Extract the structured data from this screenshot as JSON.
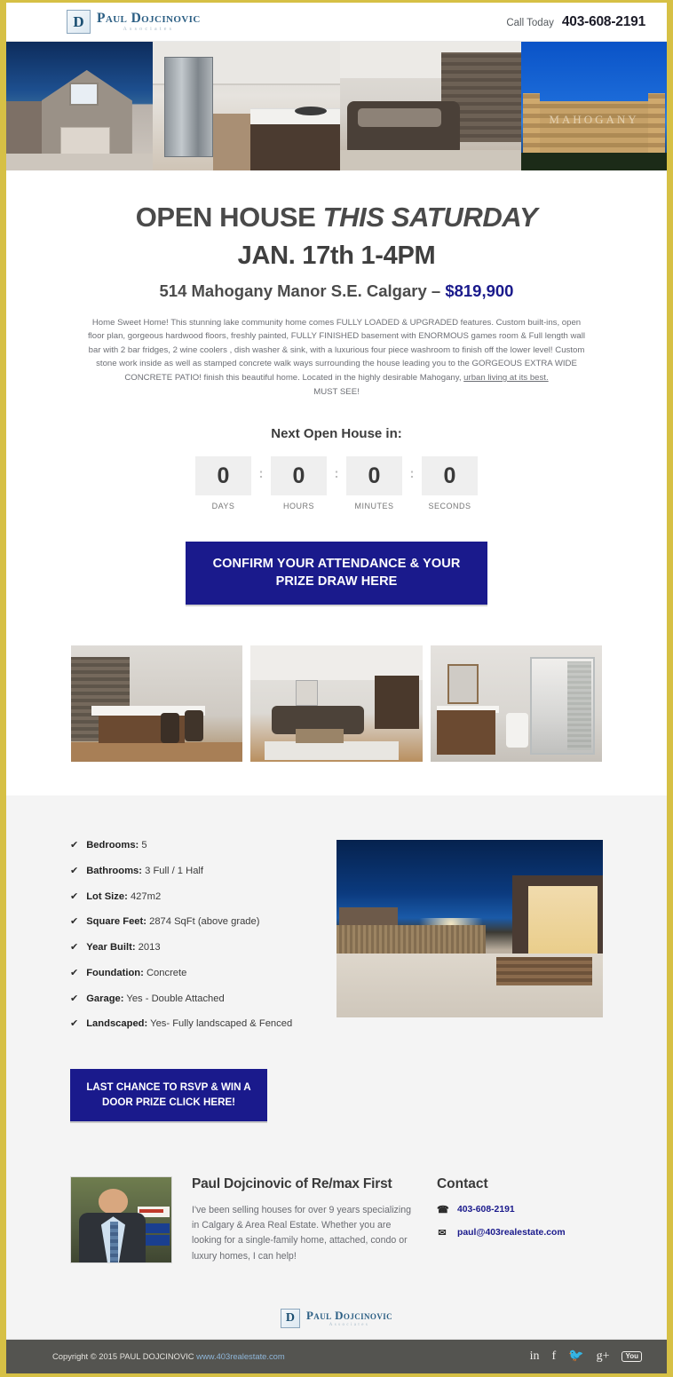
{
  "brand": {
    "monogram": "D",
    "name": "Paul Dojcinovic",
    "tagline": "Associates"
  },
  "header": {
    "call_label": "Call Today",
    "phone": "403-608-2191"
  },
  "hero": {
    "images": [
      {
        "alt": "house-exterior-evening"
      },
      {
        "alt": "kitchen-interior"
      },
      {
        "alt": "living-room-interior"
      },
      {
        "alt": "mahogany-community-entrance-sign",
        "sign_text": "MAHOGANY"
      }
    ]
  },
  "headline": {
    "line1_strong": "OPEN HOUSE ",
    "line1_em": "THIS SATURDAY",
    "line2": "JAN. 17th 1-4PM",
    "address": "514 Mahogany Manor S.E. Calgary – ",
    "price": "$819,900"
  },
  "description": {
    "p1": "Home Sweet Home! This stunning lake community home comes FULLY LOADED & UPGRADED features. Custom built-ins, open floor plan, gorgeous hardwood floors, freshly painted, FULLY FINISHED basement with ENORMOUS games room & Full length wall bar with 2 bar fridges, 2 wine coolers , dish washer & sink, with a luxurious four piece washroom to finish off the lower level! Custom stone work inside as well as stamped concrete walk ways surrounding the house leading you to the GORGEOUS EXTRA WIDE CONCRETE PATIO! finish this beautiful home. Located in the highly desirable Mahogany, ",
    "p1_underlined": "urban living at its best.",
    "must_see": "MUST SEE!"
  },
  "countdown": {
    "title": "Next Open House in:",
    "separator": ":",
    "units": [
      {
        "value": "0",
        "label": "DAYS"
      },
      {
        "value": "0",
        "label": "HOURS"
      },
      {
        "value": "0",
        "label": "MINUTES"
      },
      {
        "value": "0",
        "label": "SECONDS"
      }
    ]
  },
  "cta_primary": {
    "label": "CONFIRM YOUR ATTENDANCE & YOUR PRIZE DRAW HERE"
  },
  "gallery": {
    "images": [
      {
        "alt": "basement-bar-area"
      },
      {
        "alt": "living-room-with-sectional"
      },
      {
        "alt": "bathroom-with-glass-shower"
      }
    ]
  },
  "features": [
    {
      "label": "Bedrooms:",
      "value": "5"
    },
    {
      "label": "Bathrooms:",
      "value": "3 Full / 1 Half"
    },
    {
      "label": "Lot Size:",
      "value": "427m2"
    },
    {
      "label": "Square Feet:",
      "value": "2874 SqFt (above grade)"
    },
    {
      "label": "Year Built:",
      "value": "2013"
    },
    {
      "label": "Foundation:",
      "value": "Concrete"
    },
    {
      "label": "Garage:",
      "value": "Yes - Double Attached"
    },
    {
      "label": "Landscaped:",
      "value": "Yes- Fully landscaped & Fenced"
    }
  ],
  "property_image": {
    "alt": "backyard-patio-evening"
  },
  "cta_secondary": {
    "label": "LAST CHANCE TO RSVP & WIN A DOOR PRIZE CLICK HERE!"
  },
  "agent": {
    "photo_alt": "paul-dojcinovic-headshot",
    "name": "Paul Dojcinovic of Re/max First",
    "bio": "I've been selling houses for over 9 years specializing in Calgary & Area Real Estate. Whether you are looking for a single-family home, attached, condo or luxury homes, I can help!"
  },
  "contact": {
    "title": "Contact",
    "phone_icon": "phone-icon",
    "phone": "403-608-2191",
    "email_icon": "envelope-icon",
    "email": "paul@403realestate.com"
  },
  "footer": {
    "copyright": "Copyright  © 2015 PAUL DOJCINOVIC ",
    "link": "www.403realestate.com",
    "socials": [
      {
        "name": "linkedin",
        "glyph": "in"
      },
      {
        "name": "facebook",
        "glyph": "f"
      },
      {
        "name": "twitter",
        "glyph": "🐦"
      },
      {
        "name": "googleplus",
        "glyph": "g+"
      },
      {
        "name": "youtube",
        "glyph": "You"
      }
    ]
  },
  "colors": {
    "border_gold": "#d6c045",
    "cta_navy": "#1a1a8c",
    "footer_gray": "#545450",
    "section_gray": "#f4f4f4"
  }
}
